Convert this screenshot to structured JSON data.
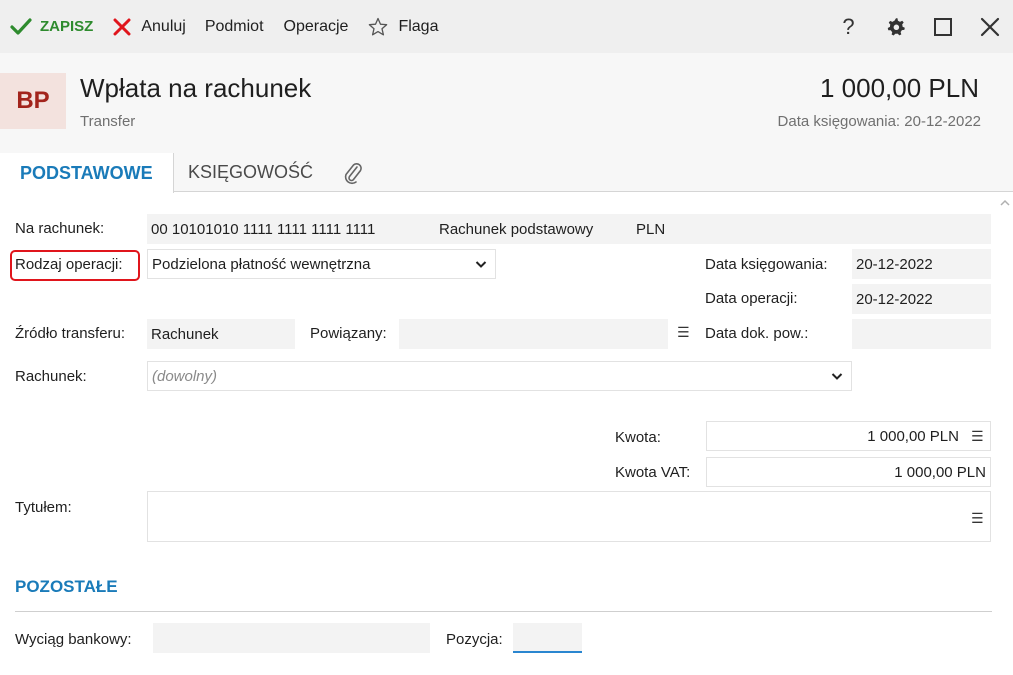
{
  "toolbar": {
    "save_label": "ZAPISZ",
    "cancel_label": "Anuluj",
    "subject_label": "Podmiot",
    "operations_label": "Operacje",
    "flag_label": "Flaga",
    "help_label": "?",
    "icons": [
      "check-icon",
      "close-x-icon",
      "star-icon",
      "help-icon",
      "gear-icon",
      "maximize-icon",
      "window-close-icon"
    ]
  },
  "header": {
    "avatar": "BP",
    "title": "Wpłata na rachunek",
    "subtitle": "Transfer",
    "amount": "1 000,00 PLN",
    "posting_date": "Data księgowania: 20-12-2022"
  },
  "tabs": [
    {
      "label": "PODSTAWOWE",
      "active": true
    },
    {
      "label": "KSIĘGOWOŚĆ",
      "active": false
    },
    {
      "label": "",
      "icon": "paperclip-icon"
    }
  ],
  "form": {
    "to_account_label": "Na rachunek:",
    "to_account_number": "00 10101010 1111 1111 1111 1111",
    "to_account_name": "Rachunek podstawowy",
    "to_account_currency": "PLN",
    "operation_type_label": "Rodzaj operacji:",
    "operation_type_value": "Podzielona płatność wewnętrzna",
    "posting_date_label": "Data księgowania:",
    "posting_date_value": "20-12-2022",
    "operation_date_label": "Data operacji:",
    "operation_date_value": "20-12-2022",
    "source_label": "Źródło transferu:",
    "source_value": "Rachunek",
    "related_label": "Powiązany:",
    "related_value": "",
    "doc_date_label": "Data dok. pow.:",
    "doc_date_value": "",
    "account_label": "Rachunek:",
    "account_placeholder": "(dowolny)",
    "amount_label": "Kwota:",
    "amount_value": "1 000,00 PLN",
    "vat_label": "Kwota VAT:",
    "vat_value": "1 000,00 PLN",
    "title_label": "Tytułem:",
    "title_value": ""
  },
  "other": {
    "section_label": "POZOSTAŁE",
    "statement_label": "Wyciąg bankowy:",
    "statement_value": "",
    "position_label": "Pozycja:",
    "position_value": ""
  },
  "colors": {
    "accent": "#1a7bb9",
    "save_green": "#2e8b2e",
    "cancel_red": "#e0151c",
    "avatar_bg": "#f3e2de",
    "avatar_text": "#a2241c",
    "highlight_frame": "#e0151c"
  }
}
